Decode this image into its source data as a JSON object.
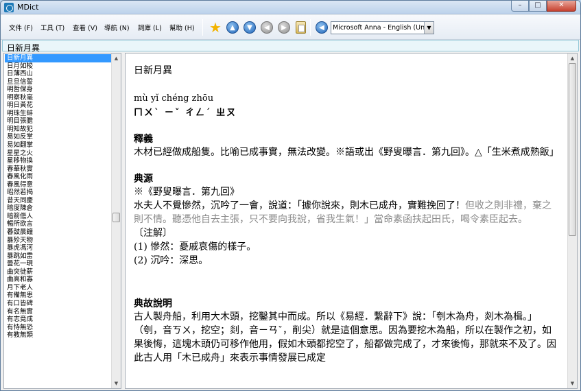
{
  "window": {
    "title": "MDict",
    "min": "–",
    "max": "□",
    "close": "✕"
  },
  "menu": [
    {
      "id": "file",
      "label": "文件 (F)"
    },
    {
      "id": "tools",
      "label": "工具 (T)"
    },
    {
      "id": "view",
      "label": "查看 (V)"
    },
    {
      "id": "navigate",
      "label": "導航 (N)"
    },
    {
      "id": "library",
      "label": "詞庫 (L)"
    },
    {
      "id": "help",
      "label": "幫助 (H)"
    }
  ],
  "toolbar": {
    "icons": [
      "star-icon",
      "arrow-up-icon",
      "arrow-down-icon",
      "arrow-left-icon",
      "arrow-right-icon",
      "clipboard-icon",
      "speak-icon"
    ],
    "voice": "Microsoft Anna - English (Unit",
    "dropdown_arrow": "▼"
  },
  "search": {
    "value": "日新月異"
  },
  "wordlist": {
    "selected_index": 0,
    "items": [
      "日新月異",
      "日月如梭",
      "日薄西山",
      "旦旦信誓",
      "明哲保身",
      "明察秋毫",
      "明日黃花",
      "明珠生蚌",
      "明目張膽",
      "明知故犯",
      "易如反掌",
      "易如翻掌",
      "星星之火",
      "星移物換",
      "春華秋實",
      "春風化雨",
      "春風得意",
      "昭然若揭",
      "昔天同慶",
      "暗度陳倉",
      "暗箭傷人",
      "暢所欲言",
      "暮鼓晨鐘",
      "暴殄天物",
      "暴虎馮河",
      "暴跳如雷",
      "曇花一現",
      "曲突徙薪",
      "曲高和寡",
      "月下老人",
      "有備無患",
      "有口皆碑",
      "有名無實",
      "有志竟成",
      "有恃無恐",
      "有教無類"
    ]
  },
  "article": {
    "headword": "日新月異",
    "pinyin": "mù yǐ chéng zhōu",
    "zhuyin": "ㄇㄨˋ  ㄧˇ  ㄔㄥˊ  ㄓㄡ",
    "sections": [
      {
        "title": "釋義",
        "paras": [
          {
            "text": "木材已經做成船隻。比喻已成事實，無法改變。※語或出《野叟曝言．第九回》。△「生米煮成熟飯」"
          }
        ]
      },
      {
        "title": "典源",
        "paras": [
          {
            "text": "※《野叟曝言．第九回》"
          },
          {
            "text": "水夫人不覺慘然，沉吟了一會，說道：「據你說來，則木已成舟，實難挽回了！",
            "grey": "但收之則非禮，棄之則不情。聽憑他自去主張，只不要向我說，省我生氣！」當命素函扶起田氏，喝令素臣起去。"
          },
          {
            "text": "〔注解〕"
          },
          {
            "text": "(1) 慘然：憂戚哀傷的樣子。"
          },
          {
            "text": "(2) 沉吟：深思。"
          }
        ]
      },
      {
        "title": "典故說明",
        "paras": [
          {
            "text": "古人製舟船，利用大木頭，挖鑿其中而成。所以《易經．繫辭下》說：「刳木為舟，剡木為楫。」（刳，音ㄎㄨ，挖空；剡，音ㄧㄢˇ，削尖）就是這個意思。因為要挖木為船，所以在製作之初，如果後悔，這塊木頭仍可移作他用，假如木頭都挖空了，船都做完成了，才來後悔，那就來不及了。因此古人用「木已成舟」來表示事情發展已成定"
          }
        ]
      }
    ]
  }
}
